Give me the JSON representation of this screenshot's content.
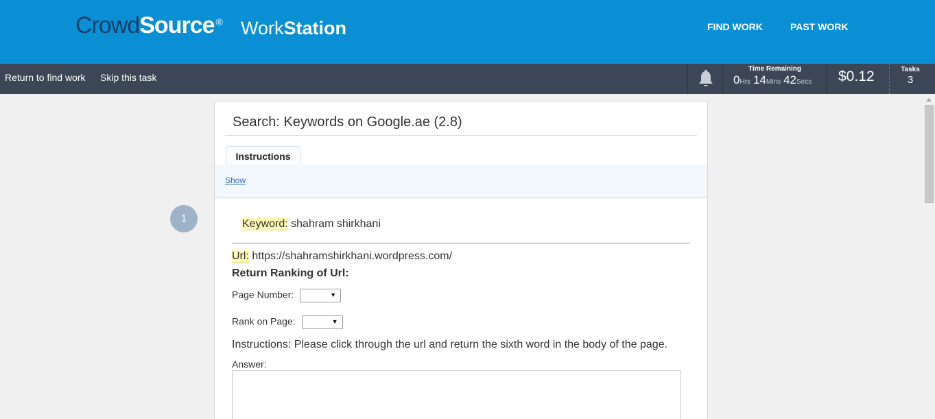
{
  "header": {
    "brand_crowd": "Crowd",
    "brand_source": "Source",
    "brand_reg": "®",
    "product_light": "Work",
    "product_bold": "Station",
    "nav": [
      "FIND WORK",
      "PAST WORK"
    ]
  },
  "subbar": {
    "return_link": "Return to find work",
    "skip_link": "Skip this task",
    "notifications_icon": "bell-icon",
    "time_label": "Time Remaining",
    "time": {
      "hours": "0",
      "hours_unit": "Hrs",
      "mins": "14",
      "mins_unit": "Mins",
      "secs": "42",
      "secs_unit": "Secs"
    },
    "earnings": "$0.12",
    "tasks_label": "Tasks",
    "tasks_count": "3"
  },
  "task": {
    "title": "Search: Keywords on Google.ae (2.8)",
    "tab_label": "Instructions",
    "show_link": "Show",
    "step_number": "1",
    "keyword_label": "Keyword:",
    "keyword_value": "shahram shirkhani",
    "url_label": "Url:",
    "url_value": "https://shahramshirkhani.wordpress.com/",
    "rank_heading": "Return Ranking of Url:",
    "page_number_label": "Page Number:",
    "page_number_value": "",
    "rank_label": "Rank on Page:",
    "rank_value": "",
    "instructions": "Instructions: Please click through the url and return the sixth word in the body of the page.",
    "answer_label": "Answer:",
    "answer_value": ""
  },
  "colors": {
    "header_blue": "#0a8fd5",
    "subbar_dark": "#3d4656",
    "highlight": "#fdf9b4",
    "step_circle": "#9fb3c8"
  }
}
